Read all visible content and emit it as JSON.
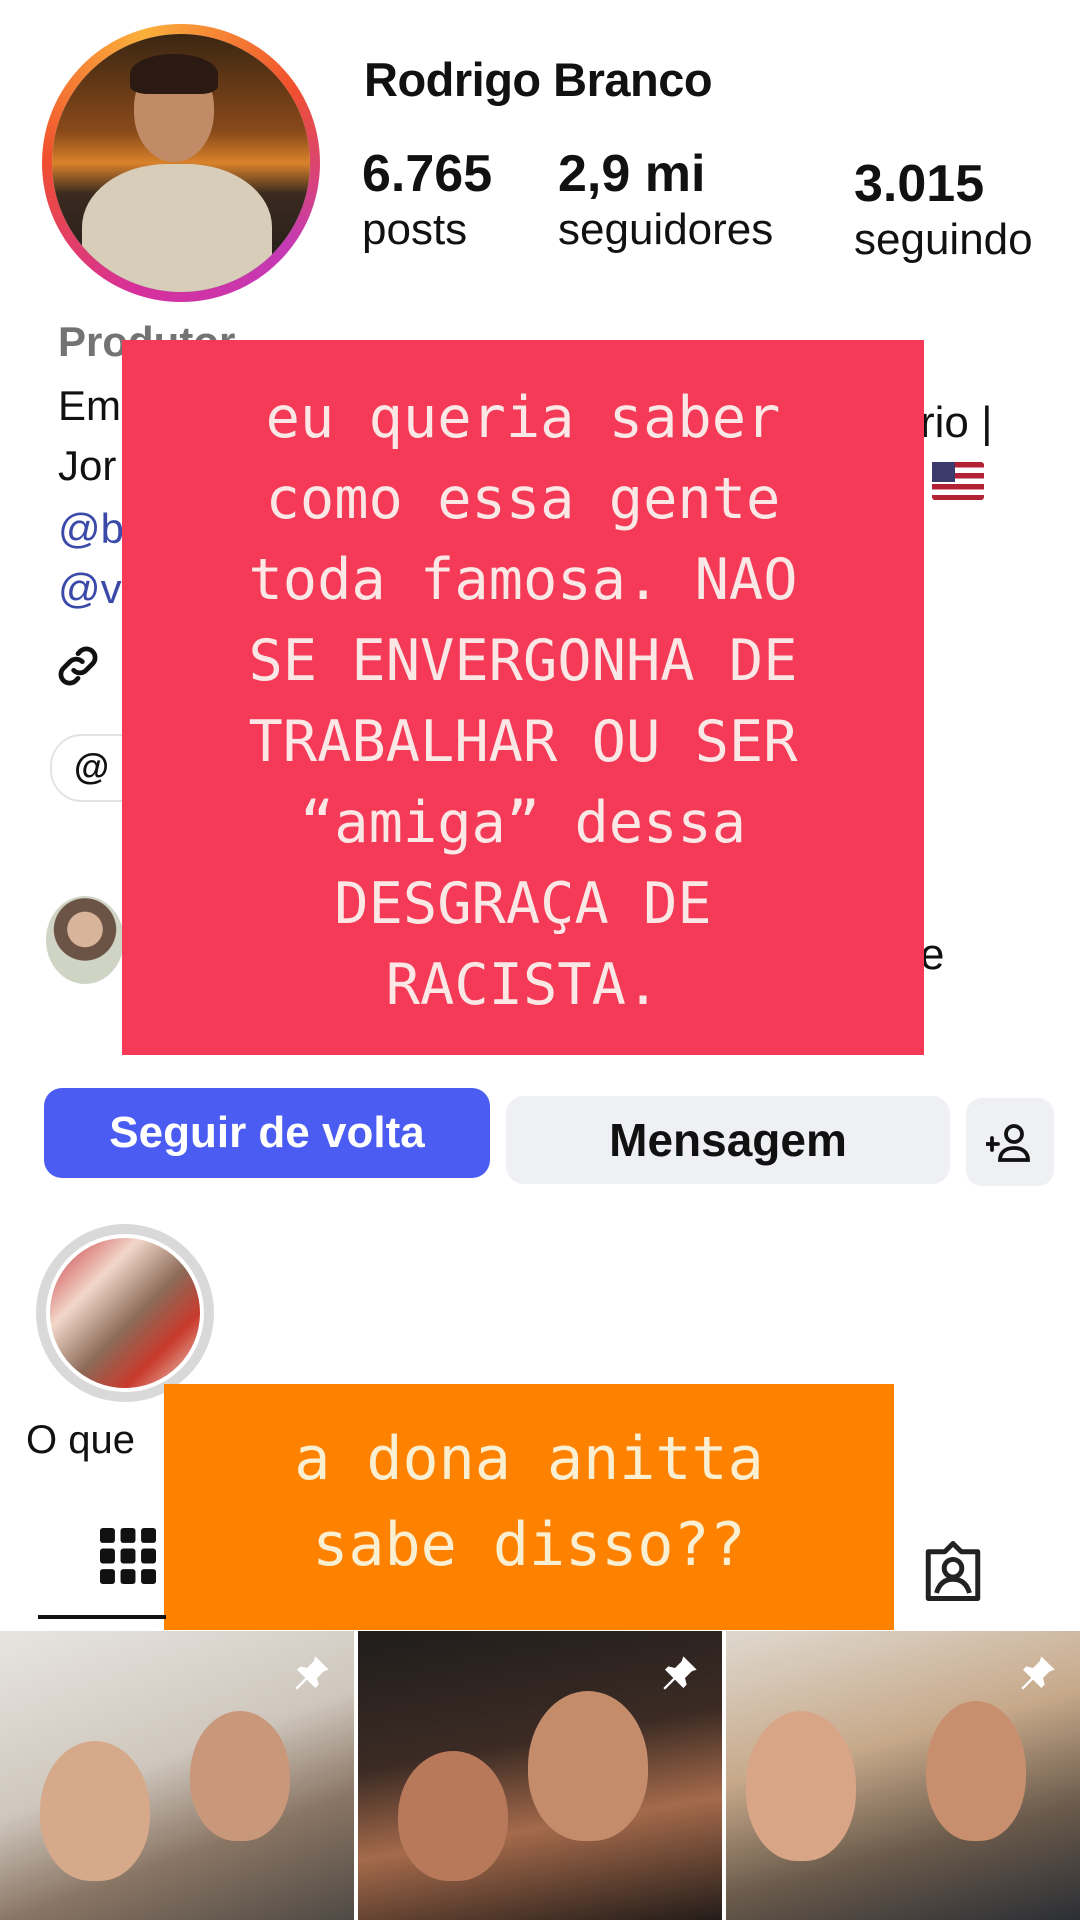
{
  "profile": {
    "username": "Rodrigo Branco",
    "stats": {
      "posts_count": "6.765",
      "posts_label": "posts",
      "followers_count": "2,9 mi",
      "followers_label": "seguidores",
      "following_count": "3.015",
      "following_label": "seguindo"
    },
    "bio": {
      "category": "Produtor",
      "line1": "Em",
      "line1_end": "rio |",
      "line2": "Jor",
      "line3": "@b",
      "line4": "@v"
    },
    "followed_by_end": "e",
    "threads_badge": "@"
  },
  "overlays": {
    "red_text": "eu queria saber\ncomo essa gente\ntoda famosa. NAO\nSE ENVERGONHA DE\nTRABALHAR OU SER\n“amiga” dessa\nDESGRAÇA DE\nRACISTA.",
    "orange_text": "a dona anitta\nsabe disso??"
  },
  "actions": {
    "follow_back": "Seguir de volta",
    "message": "Mensagem"
  },
  "highlight": {
    "title": "O que"
  },
  "colors": {
    "follow_button": "#4a5cf2",
    "red_overlay": "#f43a56",
    "orange_overlay": "#ff8100"
  },
  "icons": [
    "link-icon",
    "threads-icon",
    "flag-us-icon",
    "add-person-icon",
    "grid-icon",
    "tagged-icon",
    "pin-icon"
  ]
}
